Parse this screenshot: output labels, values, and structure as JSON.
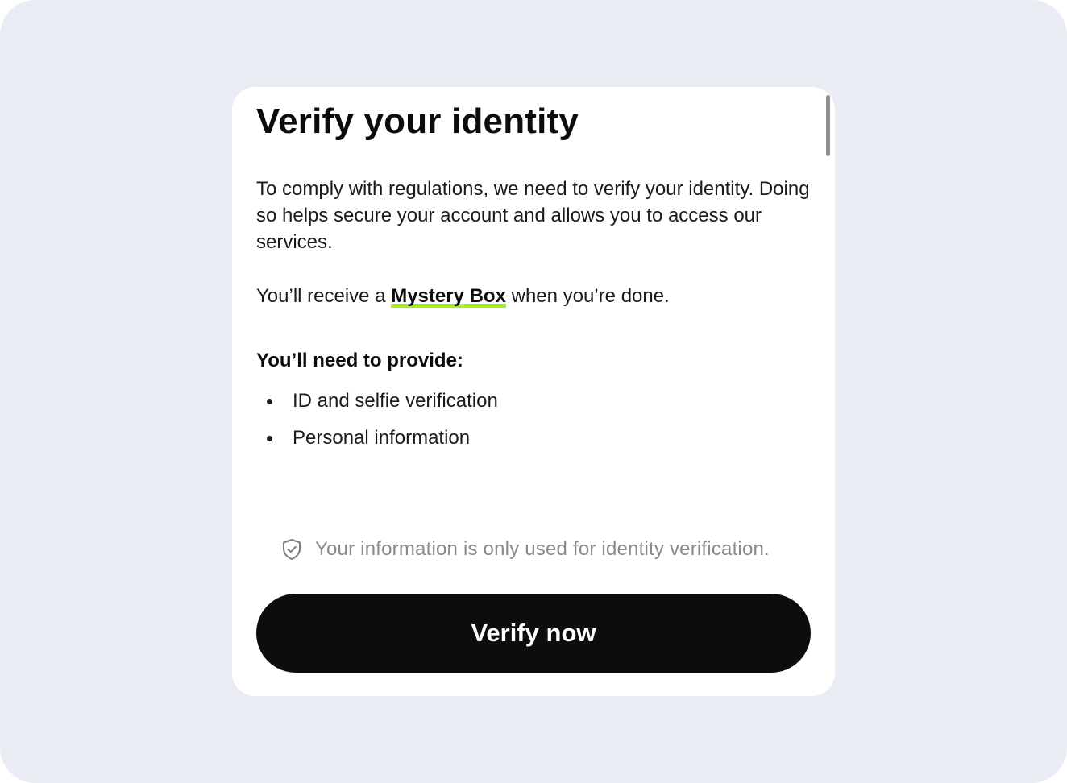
{
  "dialog": {
    "title": "Verify your identity",
    "intro": "To comply with regulations, we need to verify your identity. Doing so helps secure your account and allows you to access our services.",
    "reward": {
      "prefix": "You’ll receive a ",
      "highlight": "Mystery Box",
      "suffix": " when you’re done."
    },
    "requirements_heading": "You’ll need to provide:",
    "requirements": [
      "ID and selfie verification",
      "Personal information"
    ],
    "privacy_note": "Your information is only used for identity verification.",
    "privacy_icon": "shield-check-icon",
    "verify_button": "Verify now"
  },
  "colors": {
    "background": "#e9ecf3",
    "card": "#ffffff",
    "button": "#0d0d0d",
    "highlight_underline": "#a3ef2a",
    "muted_text": "#8a8a8a"
  }
}
